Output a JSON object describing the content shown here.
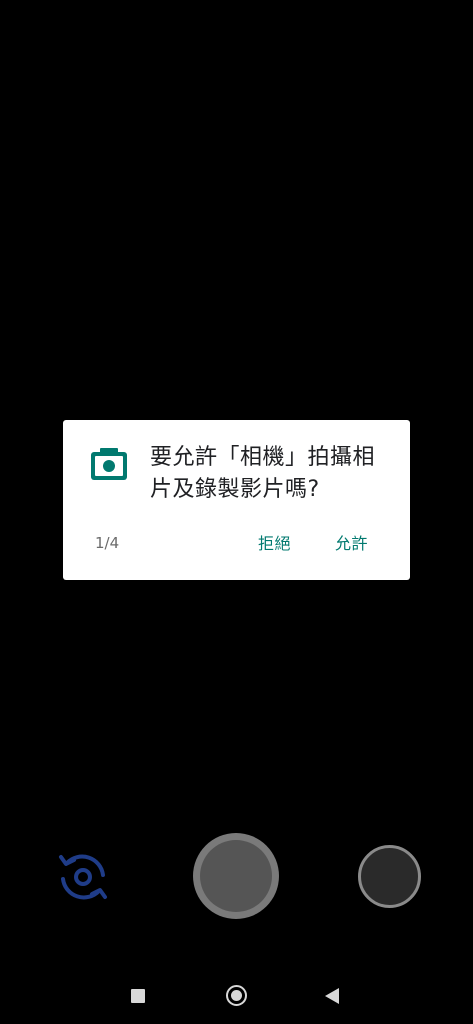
{
  "dialog": {
    "icon": "camera-icon",
    "message": "要允許「相機」拍攝相片及錄製影片嗎?",
    "counter": "1/4",
    "deny_label": "拒絕",
    "allow_label": "允許",
    "accent_color": "#01796f"
  },
  "camera_controls": {
    "switch_icon": "switch-camera-icon",
    "switch_color": "#1f3c88",
    "shutter_icon": "shutter-button",
    "gallery_icon": "gallery-thumbnail"
  },
  "navigation": {
    "recents_icon": "square-icon",
    "home_icon": "circle-icon",
    "back_icon": "triangle-back-icon"
  }
}
